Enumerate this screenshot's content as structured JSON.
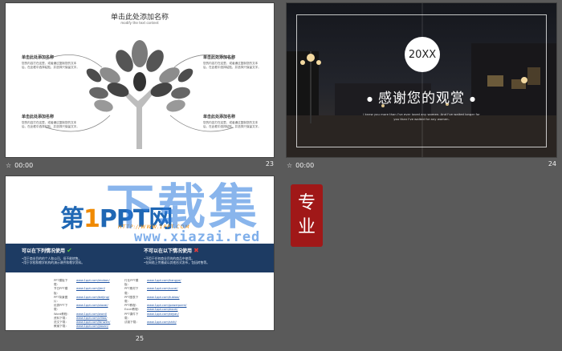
{
  "slides": [
    {
      "number": "23",
      "time": "00:00",
      "title": "单击此处添加名称",
      "subtitle": "modify the text content",
      "boxes": [
        {
          "heading": "单击此处添加名称",
          "body": "您的内容打在这里，或者通过复制您的文本后，在此框中选择粘贴，并选择只保留文字。"
        },
        {
          "heading": "单击此处添加名称",
          "body": "您的内容打在这里，或者通过复制您的文本后，在此框中选择粘贴，并选择只保留文字。"
        },
        {
          "heading": "单击此处添加名称",
          "body": "您的内容打在这里，或者通过复制您的文本后，在此框中选择粘贴，并选择只保留文字。"
        },
        {
          "heading": "单击此处添加名称",
          "body": "您的内容打在这里，或者通过复制您的文本后，在此框中选择粘贴，并选择只保留文字。"
        }
      ]
    },
    {
      "number": "24",
      "time": "00:00",
      "badge": "20XX",
      "thanks": "感谢您的观赏",
      "line1": "I knew you more than I've ever loved any women. And I've waited longer for",
      "line2": "you than I've waited for any women."
    },
    {
      "number": "25",
      "logo_first": "第",
      "logo_one": "1",
      "logo_rest": "PPT网",
      "logo_url": "HTTP://WWW.1PPT.COM",
      "can_title": "可以在下列情况使用",
      "can_lines": [
        "•用于商业目的的个人和公司，但不能转售。",
        "•用于学校和教学机构的演示课件和教学资料。"
      ],
      "cannot_title": "不可以在以下情况使用",
      "cannot_lines": [
        "•不用于任何商业目的的商品中使用。",
        "•在网络上传播或以其他形式发布，包括转售等。"
      ],
      "links_left": [
        {
          "k": "PPT模板下载：",
          "v": "www.1ppt.com/moban/"
        },
        {
          "k": "节日PPT模板：",
          "v": "www.1ppt.com/jieri/"
        },
        {
          "k": "PPT背景图片：",
          "v": "www.1ppt.com/beijing/"
        },
        {
          "k": "优秀PPT下载：",
          "v": "www.1ppt.com/xiazai/"
        },
        {
          "k": "Word教程：",
          "v": "www.1ppt.com/word/"
        },
        {
          "k": "资料下载：",
          "v": "www.1ppt.com/ziliao/"
        },
        {
          "k": "范文下载：",
          "v": "www.1ppt.com/fanwen/"
        },
        {
          "k": "教案下载：",
          "v": "www.1ppt.com/jiaoan/"
        }
      ],
      "links_right": [
        {
          "k": "行业PPT模板：",
          "v": "www.1ppt.com/hangye/"
        },
        {
          "k": "PPT素材下载：",
          "v": "www.1ppt.com/sucai/"
        },
        {
          "k": "PPT图表下载：",
          "v": "www.1ppt.com/tubiao/"
        },
        {
          "k": "PPT教程：",
          "v": "www.1ppt.com/powerpoint/"
        },
        {
          "k": "Excel教程：",
          "v": "www.1ppt.com/excel/"
        },
        {
          "k": "PPT课件下载：",
          "v": "www.1ppt.com/kejian/"
        },
        {
          "k": "试卷下载：",
          "v": "www.1ppt.com/shiti/"
        }
      ]
    }
  ],
  "watermark": {
    "big": "下载集",
    "url": "www.xiazai.red",
    "seal_top": "专",
    "seal_bottom": "业"
  }
}
